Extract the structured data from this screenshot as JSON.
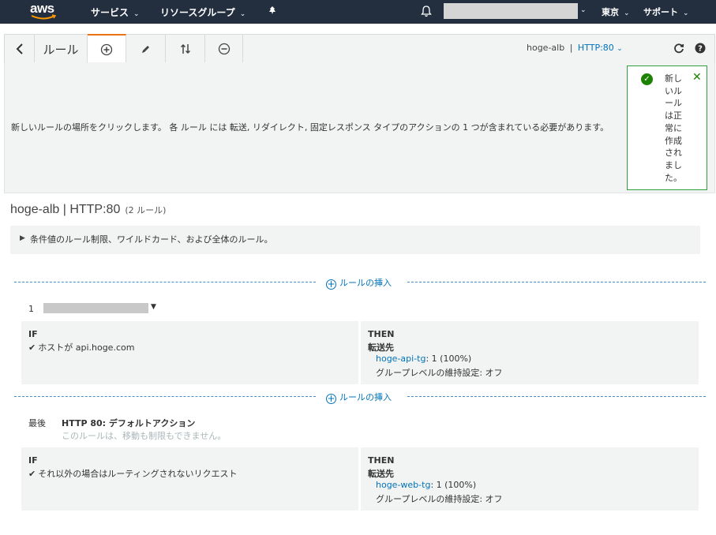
{
  "topnav": {
    "logo": "aws",
    "services": "サービス",
    "resource_groups": "リソースグループ",
    "region": "東京",
    "support": "サポート"
  },
  "toolbar": {
    "back_icon": "chevron-left-icon",
    "title": "ルール",
    "tools": [
      "add-icon",
      "pencil-icon",
      "reorder-icon",
      "remove-icon"
    ],
    "lb_name": "hoge-alb",
    "separator": "|",
    "listener": "HTTP:80",
    "refresh_icon": "refresh-icon",
    "help_icon": "help-icon"
  },
  "banner": {
    "message": "新しいルールの場所をクリックします。 各 ルール には 転送, リダイレクト, 固定レスポンス タイプのアクションの 1 つが含まれている必要があります。",
    "toast": "新しいルールは正常に作成されました。"
  },
  "heading": {
    "title": "hoge-alb | HTTP:80",
    "count": "(2 ルール)"
  },
  "expander": {
    "label": "条件値のルール制限、ワイルドカード、および全体のルール。"
  },
  "insert_label": "ルールの挿入",
  "rules": [
    {
      "number": "1",
      "if_label": "IF",
      "condition": "ホストが api.hoge.com",
      "then_label": "THEN",
      "action": "転送先",
      "target": "hoge-api-tg",
      "weight": ": 1 (100%)",
      "stickiness": "グループレベルの維持設定: オフ"
    }
  ],
  "default_rule": {
    "position": "最後",
    "title": "HTTP 80: デフォルトアクション",
    "note": "このルールは、移動も制限もできません。",
    "if_label": "IF",
    "condition": "それ以外の場合はルーティングされないリクエスト",
    "then_label": "THEN",
    "action": "転送先",
    "target": "hoge-web-tg",
    "weight": ": 1 (100%)",
    "stickiness": "グループレベルの維持設定: オフ"
  },
  "colors": {
    "nav_bg": "#232f3e",
    "accent": "#ec7211",
    "link": "#0073bb",
    "success": "#1d8102"
  }
}
